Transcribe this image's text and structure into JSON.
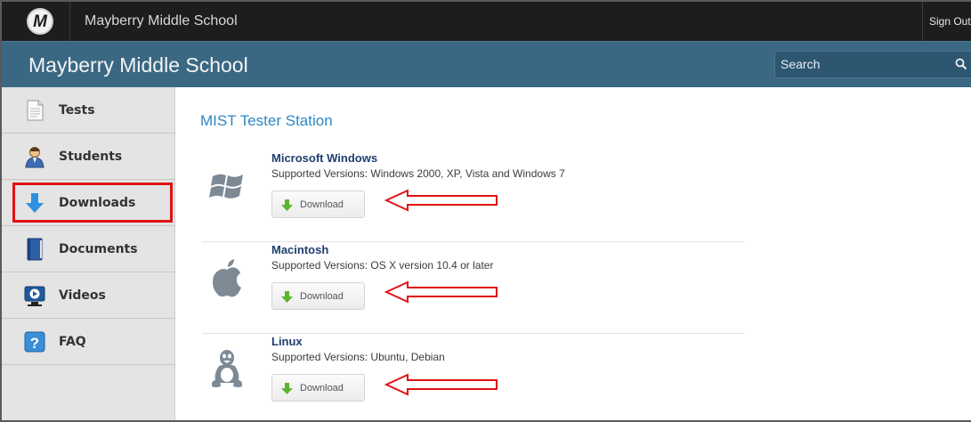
{
  "topbar": {
    "logo_letter": "M",
    "title": "Mayberry Middle School",
    "sign_out": "Sign Out"
  },
  "header": {
    "school_name": "Mayberry Middle School",
    "search_placeholder": "Search"
  },
  "sidebar": {
    "items": [
      {
        "label": "Tests",
        "icon": "document-icon"
      },
      {
        "label": "Students",
        "icon": "student-icon"
      },
      {
        "label": "Downloads",
        "icon": "download-arrow-icon",
        "highlighted": true
      },
      {
        "label": "Documents",
        "icon": "book-icon"
      },
      {
        "label": "Videos",
        "icon": "video-icon"
      },
      {
        "label": "FAQ",
        "icon": "question-icon"
      }
    ]
  },
  "main": {
    "title": "MIST Tester Station",
    "downloads": [
      {
        "name": "Microsoft Windows",
        "versions": "Supported Versions: Windows 2000, XP, Vista and Windows 7",
        "button": "Download",
        "icon": "windows-logo-icon"
      },
      {
        "name": "Macintosh",
        "versions": "Supported Versions: OS X version 10.4 or later",
        "button": "Download",
        "icon": "apple-logo-icon"
      },
      {
        "name": "Linux",
        "versions": "Supported Versions: Ubuntu, Debian",
        "button": "Download",
        "icon": "linux-tux-icon"
      }
    ]
  },
  "colors": {
    "topbar": "#1d1d1d",
    "header": "#3a6883",
    "title_blue": "#2f87c4",
    "annotation_red": "#e01212",
    "download_green": "#5ab52a"
  }
}
